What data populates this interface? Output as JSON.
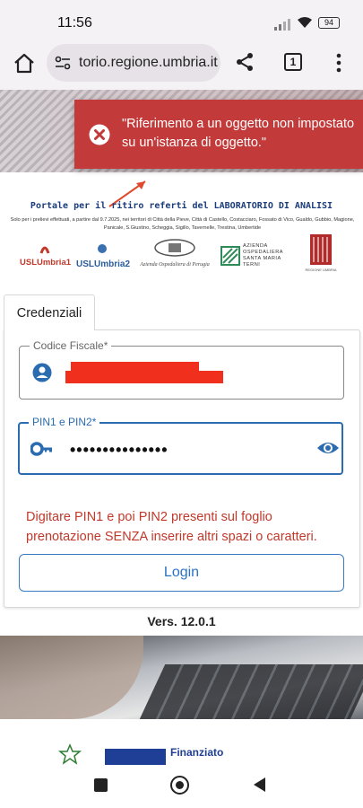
{
  "status_bar": {
    "time": "11:56",
    "battery": "94"
  },
  "browser": {
    "url": "torio.regione.umbria.it",
    "tab_count": "1"
  },
  "toast": {
    "message": "\"Riferimento a un oggetto non impostato su un'istanza di oggetto.\"",
    "color": "#c23a39"
  },
  "portal": {
    "title": "Portale per il ritiro referti del LABORATORIO DI ANALISI",
    "note": "Solo per i prelievi effettuati, a partire dal 9.7.2025, nei territori di Città della Pieve, Città di Castello, Costacciaro, Fossato di Vico, Gualdo, Gubbio, Magione, Panicale, S.Giustino, Scheggia, Sigillo, Tavernelle, Trestina, Umbertide"
  },
  "logos": {
    "usl1": "USLUmbria1",
    "usl2": "USLUmbria2",
    "aop": "Azienda Ospedaliera di Perugia",
    "sm": "AZIENDA OSPEDALIERA SANTA MARIA TERNI",
    "regione": "REGIONE UMBRIA"
  },
  "form": {
    "tab_label": "Credenziali",
    "cf_label": "Codice Fiscale*",
    "cf_value": "",
    "pin_label": "PIN1 e PIN2*",
    "pin_value": "•••••••••••••••",
    "hint": "Digitare PIN1 e poi PIN2 presenti sul foglio prenotazione SENZA inserire altri spazi o caratteri.",
    "login_label": "Login"
  },
  "version": "Vers. 12.0.1",
  "footer": {
    "eu_text": "Finanziato"
  },
  "colors": {
    "accent": "#2b6cb0",
    "error": "#c0392b",
    "redaction": "#f0301c"
  }
}
